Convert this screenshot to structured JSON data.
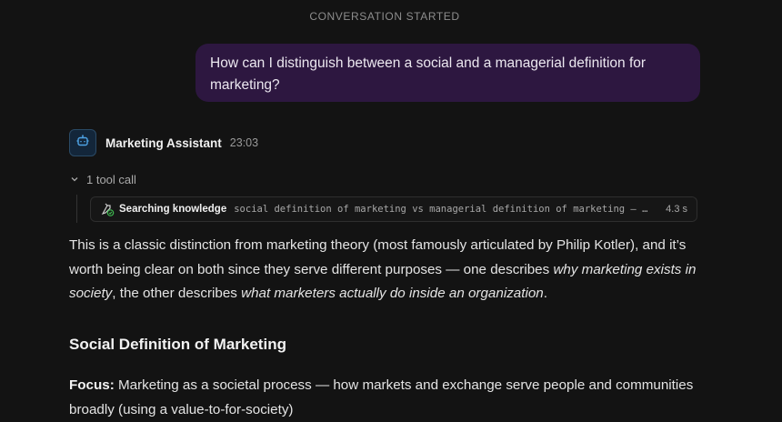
{
  "conversation": {
    "started_label": "CONVERSATION STARTED"
  },
  "user_message": {
    "text": "How can I distinguish between a social and a managerial definition for marketing?",
    "bubble_color": "#2d1740"
  },
  "assistant": {
    "name": "Marketing Assistant",
    "timestamp": "23:03",
    "avatar_icon": "robot-icon"
  },
  "tool_calls": {
    "toggle_label": "1 tool call",
    "toggle_icon": "chevron-down-icon",
    "items": [
      {
        "icon": "search-knowledge-icon",
        "label": "Searching knowledge",
        "query": "social definition of marketing vs managerial definition of marketing — 20…",
        "duration": "4.3 s"
      }
    ]
  },
  "answer": {
    "intro_part1": "This is a classic distinction from marketing theory (most famously articulated by Philip Kotler), and it’s worth being clear on both since they serve different purposes — one describes ",
    "intro_em1": "why marketing exists in society",
    "intro_part2": ", the other describes ",
    "intro_em2": "what marketers actually do inside an organization",
    "intro_part3": ".",
    "section_heading": "Social Definition of Marketing",
    "focus_label": "Focus:",
    "focus_text": " Marketing as a societal process — how markets and exchange serve people and communities broadly (using a value-to-for-society)"
  },
  "colors": {
    "background": "#131313",
    "accent_blue": "#4ea3e6",
    "success_green": "#3fb950"
  }
}
